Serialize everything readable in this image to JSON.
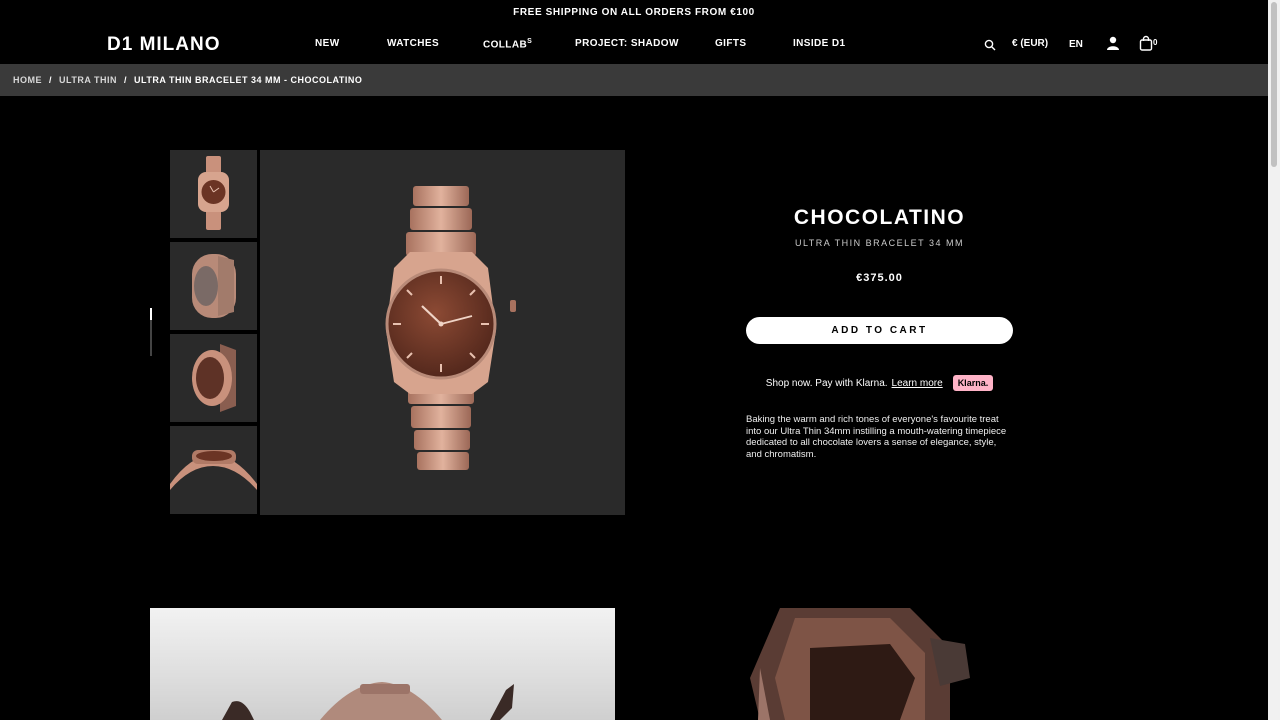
{
  "promo": {
    "text": "FREE SHIPPING ON ALL ORDERS FROM €100"
  },
  "header": {
    "logo": "D1 MILANO",
    "nav": [
      {
        "label": "NEW"
      },
      {
        "label": "WATCHES"
      },
      {
        "label": "COLLAB",
        "sup": "S"
      },
      {
        "label": "PROJECT: SHADOW"
      },
      {
        "label": "GIFTS"
      },
      {
        "label": "INSIDE D1"
      }
    ],
    "currency": "€ (EUR)",
    "language": "EN",
    "cart_count": "0"
  },
  "breadcrumb": {
    "home": "HOME",
    "category": "ULTRA THIN",
    "current": "ULTRA THIN BRACELET 34 MM - CHOCOLATINO",
    "separator": "/"
  },
  "product": {
    "title": "CHOCOLATINO",
    "subtitle": "ULTRA THIN BRACELET 34 MM",
    "price": "€375.00",
    "add_to_cart": "ADD TO CART",
    "klarna_text": "Shop now. Pay with Klarna.",
    "klarna_link": "Learn more",
    "klarna_badge": "Klarna.",
    "description": "Baking the warm and rich tones of everyone's favourite treat into our Ultra Thin 34mm instilling a mouth-watering timepiece dedicated to all chocolate lovers a sense of elegance, style, and chromatism."
  },
  "colors": {
    "watch_case": "#c9917c",
    "watch_dial": "#6b3424",
    "klarna_pink": "#ffb3c7",
    "breadcrumb_bg": "#3a3a3a"
  }
}
